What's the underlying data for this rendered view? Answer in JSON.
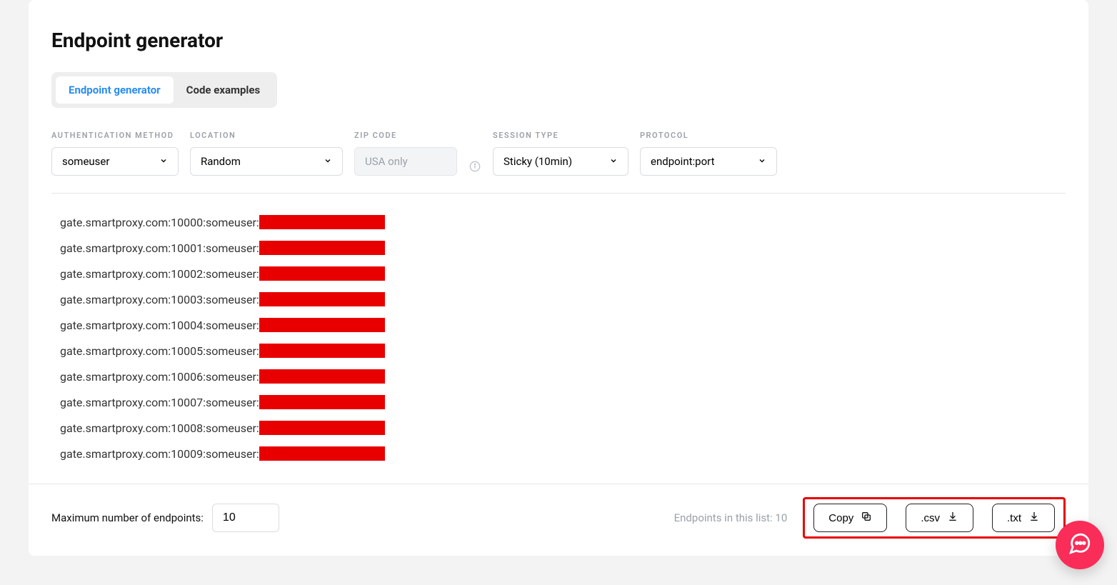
{
  "title": "Endpoint generator",
  "tabs": {
    "generator": "Endpoint generator",
    "examples": "Code examples"
  },
  "controls": {
    "auth": {
      "label": "AUTHENTICATION METHOD",
      "value": "someuser"
    },
    "location": {
      "label": "LOCATION",
      "value": "Random"
    },
    "zip": {
      "label": "ZIP CODE",
      "placeholder": "USA only"
    },
    "session": {
      "label": "SESSION TYPE",
      "value": "Sticky (10min)"
    },
    "protocol": {
      "label": "PROTOCOL",
      "value": "endpoint:port"
    }
  },
  "endpoints": [
    "gate.smartproxy.com:10000:someuser:",
    "gate.smartproxy.com:10001:someuser:",
    "gate.smartproxy.com:10002:someuser:",
    "gate.smartproxy.com:10003:someuser:",
    "gate.smartproxy.com:10004:someuser:",
    "gate.smartproxy.com:10005:someuser:",
    "gate.smartproxy.com:10006:someuser:",
    "gate.smartproxy.com:10007:someuser:",
    "gate.smartproxy.com:10008:someuser:",
    "gate.smartproxy.com:10009:someuser:"
  ],
  "footer": {
    "max_label": "Maximum number of endpoints:",
    "max_value": "10",
    "count_prefix": "Endpoints in this list: ",
    "count_value": "10",
    "copy": "Copy",
    "csv": ".csv",
    "txt": ".txt"
  }
}
